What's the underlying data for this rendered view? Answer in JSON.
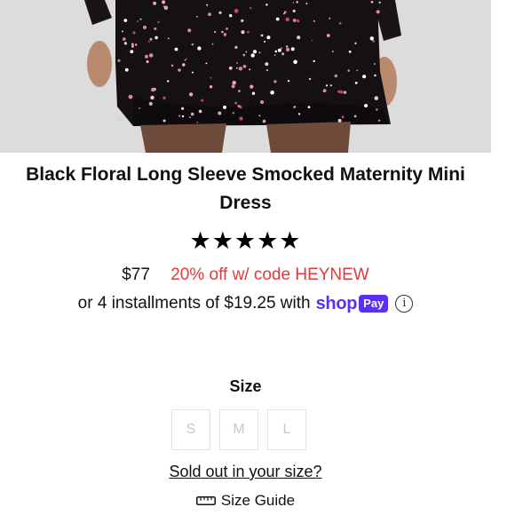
{
  "product": {
    "title": "Black Floral Long Sleeve Smocked Maternity Mini Dress",
    "rating_stars": "★★★★★",
    "rating_value": 5,
    "price": "$77",
    "promo": "20% off w/ code HEYNEW",
    "installments_text": "or 4 installments of $19.25 with",
    "shop_label": "shop",
    "pay_label": "Pay",
    "info_symbol": "i"
  },
  "size": {
    "label": "Size",
    "options": [
      "S",
      "M",
      "L"
    ],
    "sold_out_link": "Sold out in your size?",
    "guide_label": "Size Guide"
  },
  "colors": {
    "promo": "#e03a3a",
    "shop_pay": "#5a31f4",
    "hero_bg": "#d9d9d9",
    "dress": "#141014"
  }
}
